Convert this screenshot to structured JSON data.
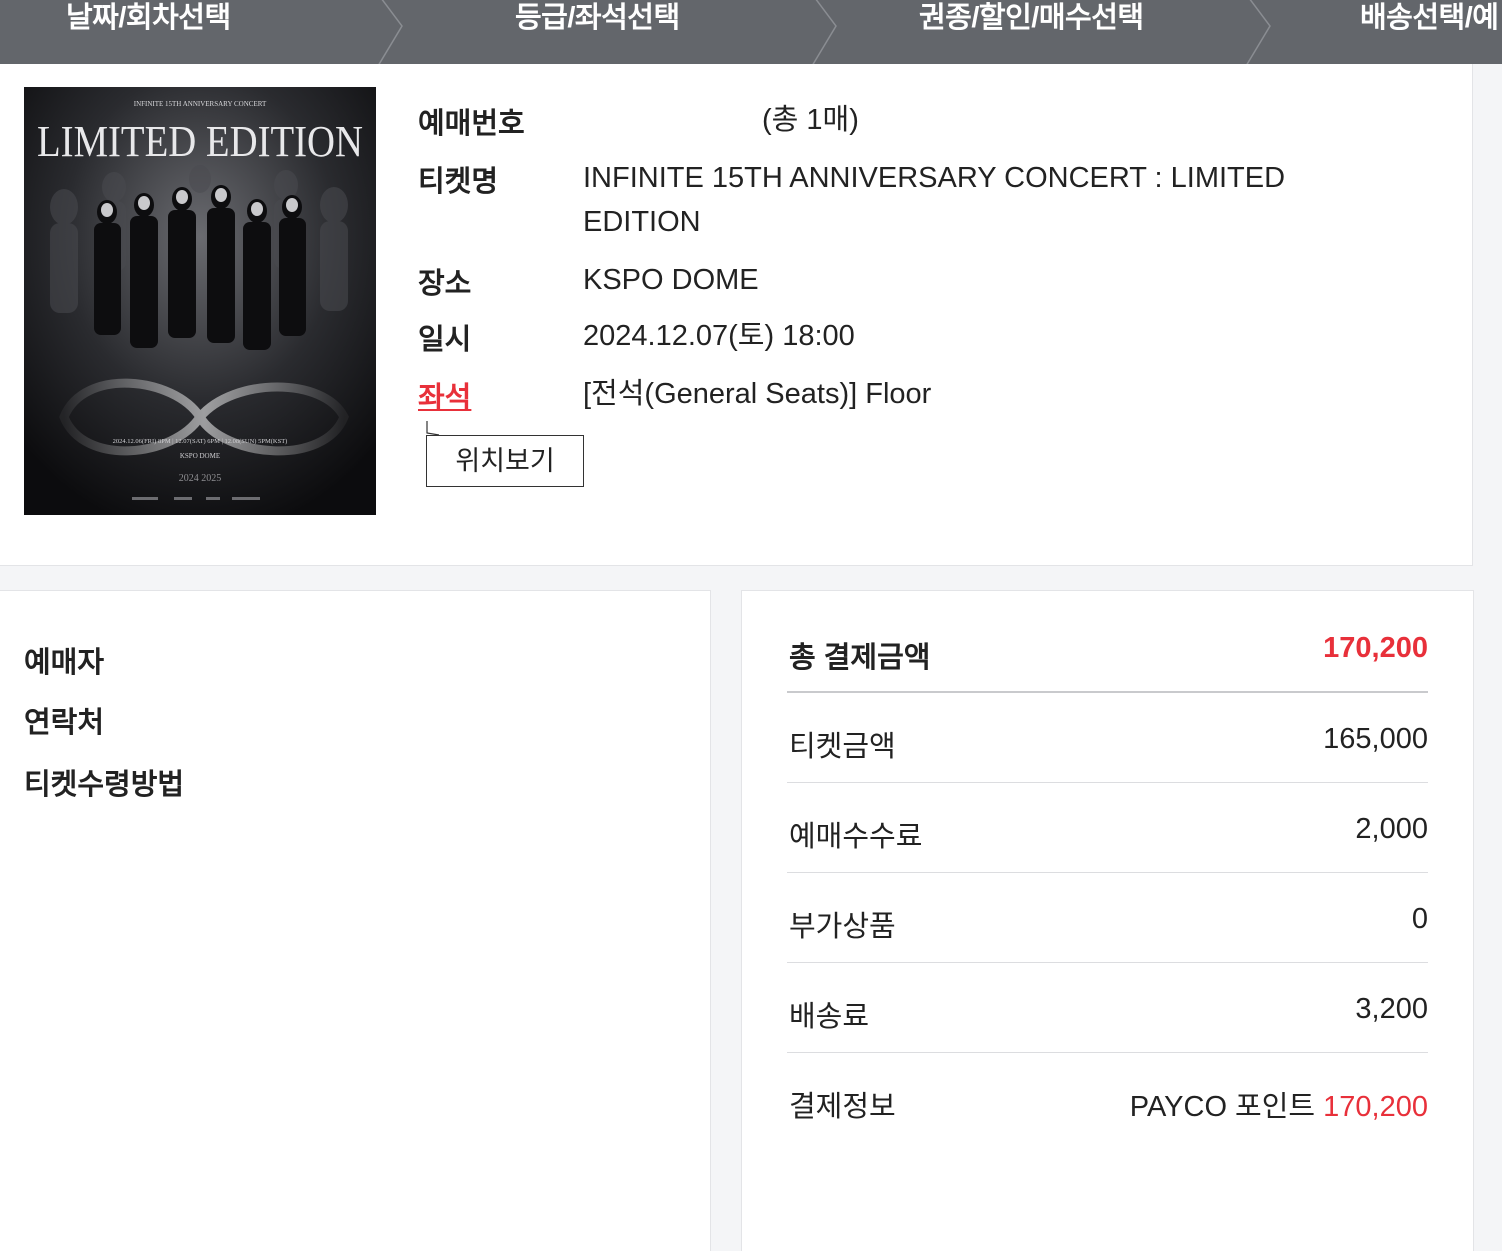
{
  "steps": [
    {
      "label": "날짜/회차선택"
    },
    {
      "label": "등급/좌석선택"
    },
    {
      "label": "권종/할인/매수선택"
    },
    {
      "label": "배송선택/예"
    }
  ],
  "ticket": {
    "booking_no_label": "예매번호",
    "booking_no_count": "(총 1매)",
    "name_label": "티켓명",
    "name_line1": "INFINITE 15TH ANNIVERSARY CONCERT : LIMITED",
    "name_line2": "EDITION",
    "venue_label": "장소",
    "venue": "KSPO DOME",
    "datetime_label": "일시",
    "datetime": "2024.12.07(토) 18:00",
    "seat_label": "좌석",
    "seat": "[전석(General Seats)] Floor",
    "location_button": "위치보기"
  },
  "poster": {
    "top_text": "INFINITE 15TH ANNIVERSARY CONCERT",
    "title": "LIMITED EDITION",
    "dates": "2024.12.06(FRI) 8PM | 12.07(SAT) 6PM | 12.08(SUN) 5PM(KST)",
    "venue": "KSPO DOME",
    "years": "2024  2025"
  },
  "booker": {
    "booker_label": "예매자",
    "contact_label": "연락처",
    "receive_label": "티켓수령방법"
  },
  "payment": {
    "total_label": "총 결제금액",
    "total_value": "170,200",
    "ticket_label": "티켓금액",
    "ticket_value": "165,000",
    "fee_label": "예매수수료",
    "fee_value": "2,000",
    "extra_label": "부가상품",
    "extra_value": "0",
    "delivery_label": "배송료",
    "delivery_value": "3,200",
    "method_label": "결제정보",
    "method_name": "PAYCO 포인트",
    "method_value": "170,200"
  },
  "colors": {
    "accent_red": "#e8303a",
    "step_bar": "#63666b"
  }
}
